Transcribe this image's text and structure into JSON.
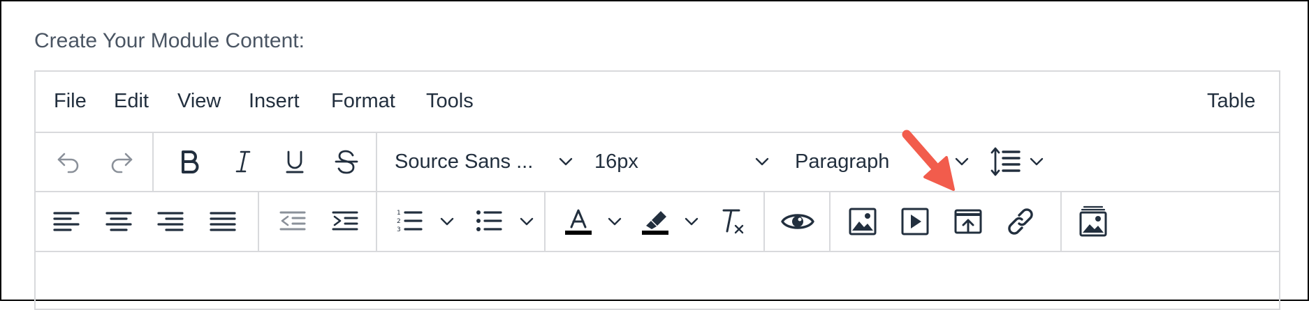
{
  "heading": "Create Your Module Content:",
  "menubar": {
    "items": [
      "File",
      "Edit",
      "View",
      "Insert",
      "Format",
      "Tools"
    ],
    "right_item": "Table"
  },
  "toolbar": {
    "font_family": "Source Sans ...",
    "font_size": "16px",
    "block_format": "Paragraph"
  },
  "colors": {
    "text": "#222f3e",
    "disabled": "#8a9099",
    "border": "#d8d9dc",
    "annotation_arrow": "#f25c4c"
  },
  "icons": {
    "row1": [
      "undo-icon",
      "redo-icon",
      "bold-icon",
      "italic-icon",
      "underline-icon",
      "strikethrough-icon",
      "line-height-icon"
    ],
    "row2": [
      "align-left-icon",
      "align-center-icon",
      "align-right-icon",
      "align-justify-icon",
      "outdent-icon",
      "indent-icon",
      "numbered-list-icon",
      "bullet-list-icon",
      "text-color-icon",
      "highlight-color-icon",
      "clear-formatting-icon",
      "preview-icon",
      "image-icon",
      "media-icon",
      "embed-upload-icon",
      "link-icon",
      "image-gallery-icon"
    ]
  }
}
